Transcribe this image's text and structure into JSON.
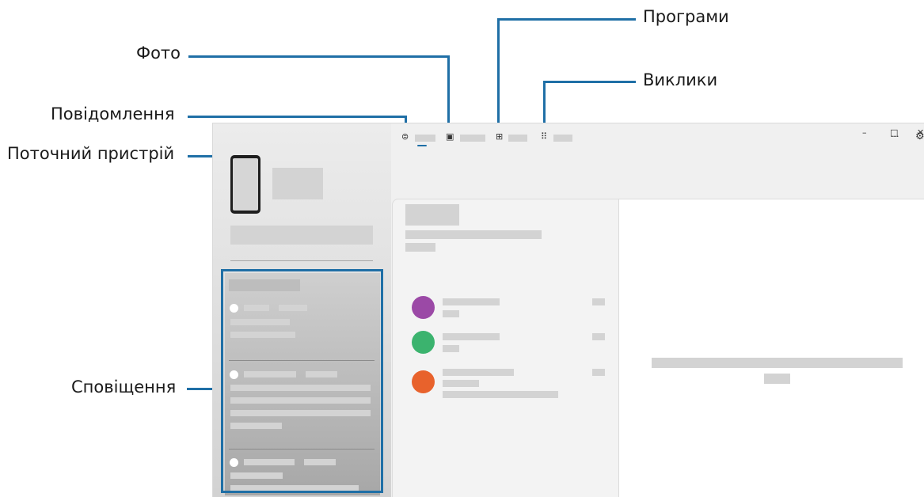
{
  "callouts": {
    "programs": "Програми",
    "photos": "Фото",
    "calls": "Виклики",
    "messages": "Повідомлення",
    "current_device": "Поточний пристрій",
    "notifications": "Сповіщення"
  },
  "window": {
    "controls": {
      "minimize": "–",
      "maximize": "□",
      "close": "✕"
    },
    "more": "···",
    "settings": "⚙"
  },
  "tabs": [
    {
      "name": "messages",
      "icon": "chat-bubble-icon",
      "glyph": "⊜"
    },
    {
      "name": "photos",
      "icon": "photo-icon",
      "glyph": "▣"
    },
    {
      "name": "apps",
      "icon": "apps-grid-icon",
      "glyph": "⊞"
    },
    {
      "name": "calls",
      "icon": "dialpad-icon",
      "glyph": "⠿"
    }
  ],
  "contacts": [
    {
      "color": "#9b49a6"
    },
    {
      "color": "#3bb36e"
    },
    {
      "color": "#e8622c"
    }
  ],
  "colors": {
    "callout_line": "#1f6fa6",
    "placeholder": "#d3d3d3"
  }
}
